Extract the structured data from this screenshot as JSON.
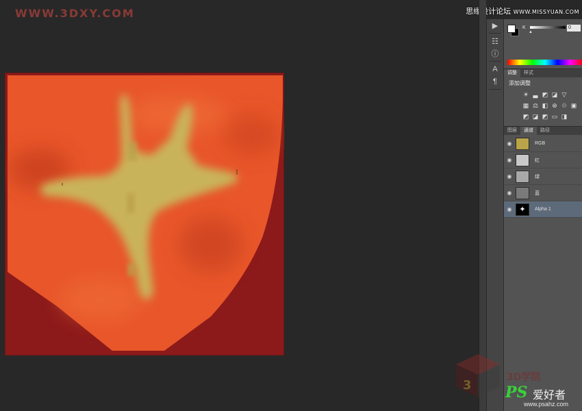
{
  "watermarks": {
    "top_left": "WWW.3DXY.COM",
    "top_right_cn": "思缘设计论坛",
    "top_right_url": "WWW.MISSYUAN.COM",
    "bottom_brand_cn": "3D学院",
    "bottom_ps": "PS",
    "bottom_ps_cn": "爱好者",
    "bottom_ps_url": "www.psahz.com"
  },
  "colors": {
    "canvas_bg": "#8c1a1a",
    "canvas_orange": "#e8562a",
    "shape_yellow": "#c9b35a",
    "panel_bg": "#535353",
    "app_bg": "#282828"
  },
  "color_panel": {
    "channel_label": "K",
    "value": "0"
  },
  "adjustments": {
    "tabs": [
      "调整",
      "样式"
    ],
    "title": "添加调整",
    "icons_row1": [
      "brightness-icon",
      "levels-icon",
      "curves-icon",
      "exposure-icon",
      "vibrance-icon"
    ],
    "icons_row2": [
      "hue-saturation-icon",
      "color-balance-icon",
      "black-white-icon",
      "photo-filter-icon",
      "channel-mixer-icon",
      "color-lookup-icon"
    ],
    "icons_row3": [
      "invert-icon",
      "posterize-icon",
      "threshold-icon",
      "gradient-map-icon",
      "selective-color-icon"
    ]
  },
  "layers_panel": {
    "tabs": [
      "图层",
      "通道",
      "路径"
    ],
    "active_tab": "通道",
    "channels": [
      {
        "name": "RGB",
        "thumb": "#b9a449",
        "selected": false
      },
      {
        "name": "红",
        "thumb": "#c8c8c8",
        "selected": false
      },
      {
        "name": "绿",
        "thumb": "#a8a8a8",
        "selected": false
      },
      {
        "name": "蓝",
        "thumb": "#7a7a7a",
        "selected": false
      },
      {
        "name": "Alpha 1",
        "thumb": "#000000",
        "selected": true
      }
    ]
  }
}
